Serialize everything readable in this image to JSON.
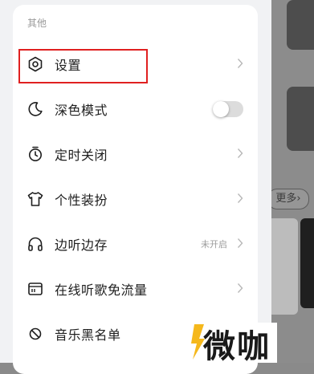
{
  "section_title": "其他",
  "menu": [
    {
      "label": "设置",
      "icon": "hexagon-settings-icon",
      "control": "chevron"
    },
    {
      "label": "深色模式",
      "icon": "moon-icon",
      "control": "toggle",
      "toggle_on": false
    },
    {
      "label": "定时关闭",
      "icon": "timer-icon",
      "control": "chevron"
    },
    {
      "label": "个性装扮",
      "icon": "tshirt-icon",
      "control": "chevron"
    },
    {
      "label": "边听边存",
      "icon": "headphones-icon",
      "control": "chevron",
      "status": "未开启"
    },
    {
      "label": "在线听歌免流量",
      "icon": "sim-card-icon",
      "control": "chevron"
    },
    {
      "label": "音乐黑名单",
      "icon": "block-icon",
      "control": "none"
    }
  ],
  "background": {
    "more_label": "更多",
    "more_chevron": "›"
  },
  "watermark": {
    "text": "微咖"
  },
  "colors": {
    "highlight_border": "#e02020",
    "panel": "#ffffff",
    "drawer": "#f1f2f4"
  }
}
